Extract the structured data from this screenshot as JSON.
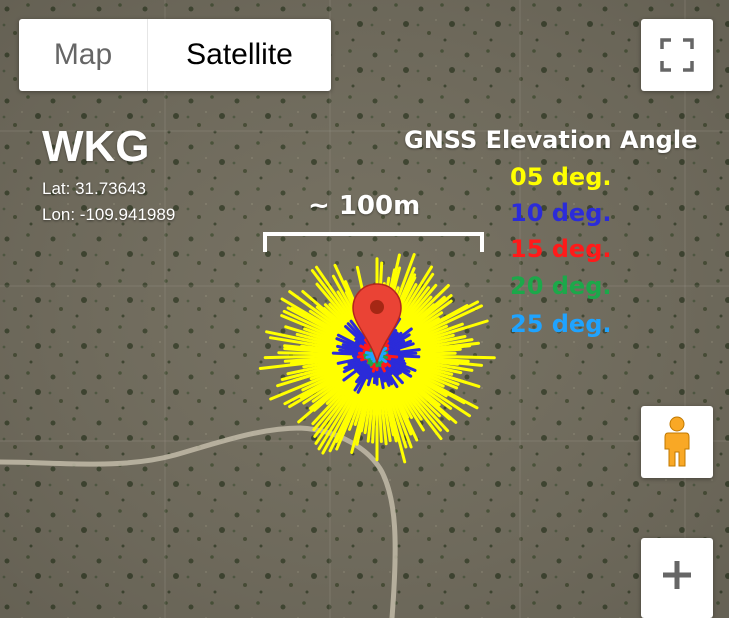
{
  "map_type_control": {
    "map_label": "Map",
    "satellite_label": "Satellite",
    "selected": "Satellite"
  },
  "site": {
    "name": "WKG",
    "lat": "Lat: 31.73643",
    "lon": "Lon: -109.941989"
  },
  "legend": {
    "title": "GNSS Elevation Angle",
    "items": [
      {
        "label": "05 deg.",
        "color": "#ffff00"
      },
      {
        "label": "10 deg.",
        "color": "#2b2bd9"
      },
      {
        "label": "15 deg.",
        "color": "#ff1a1a"
      },
      {
        "label": "20 deg.",
        "color": "#1ca84a"
      },
      {
        "label": "25 deg.",
        "color": "#1fa3ff"
      }
    ]
  },
  "scale": {
    "label": "~ 100m"
  },
  "icons": {
    "fullscreen": "fullscreen-icon",
    "pegman": "pegman-icon",
    "zoom_in": "plus-icon",
    "marker": "map-pin-icon"
  },
  "colors": {
    "marker": "#ea4335",
    "pegman": "#f9a825"
  }
}
